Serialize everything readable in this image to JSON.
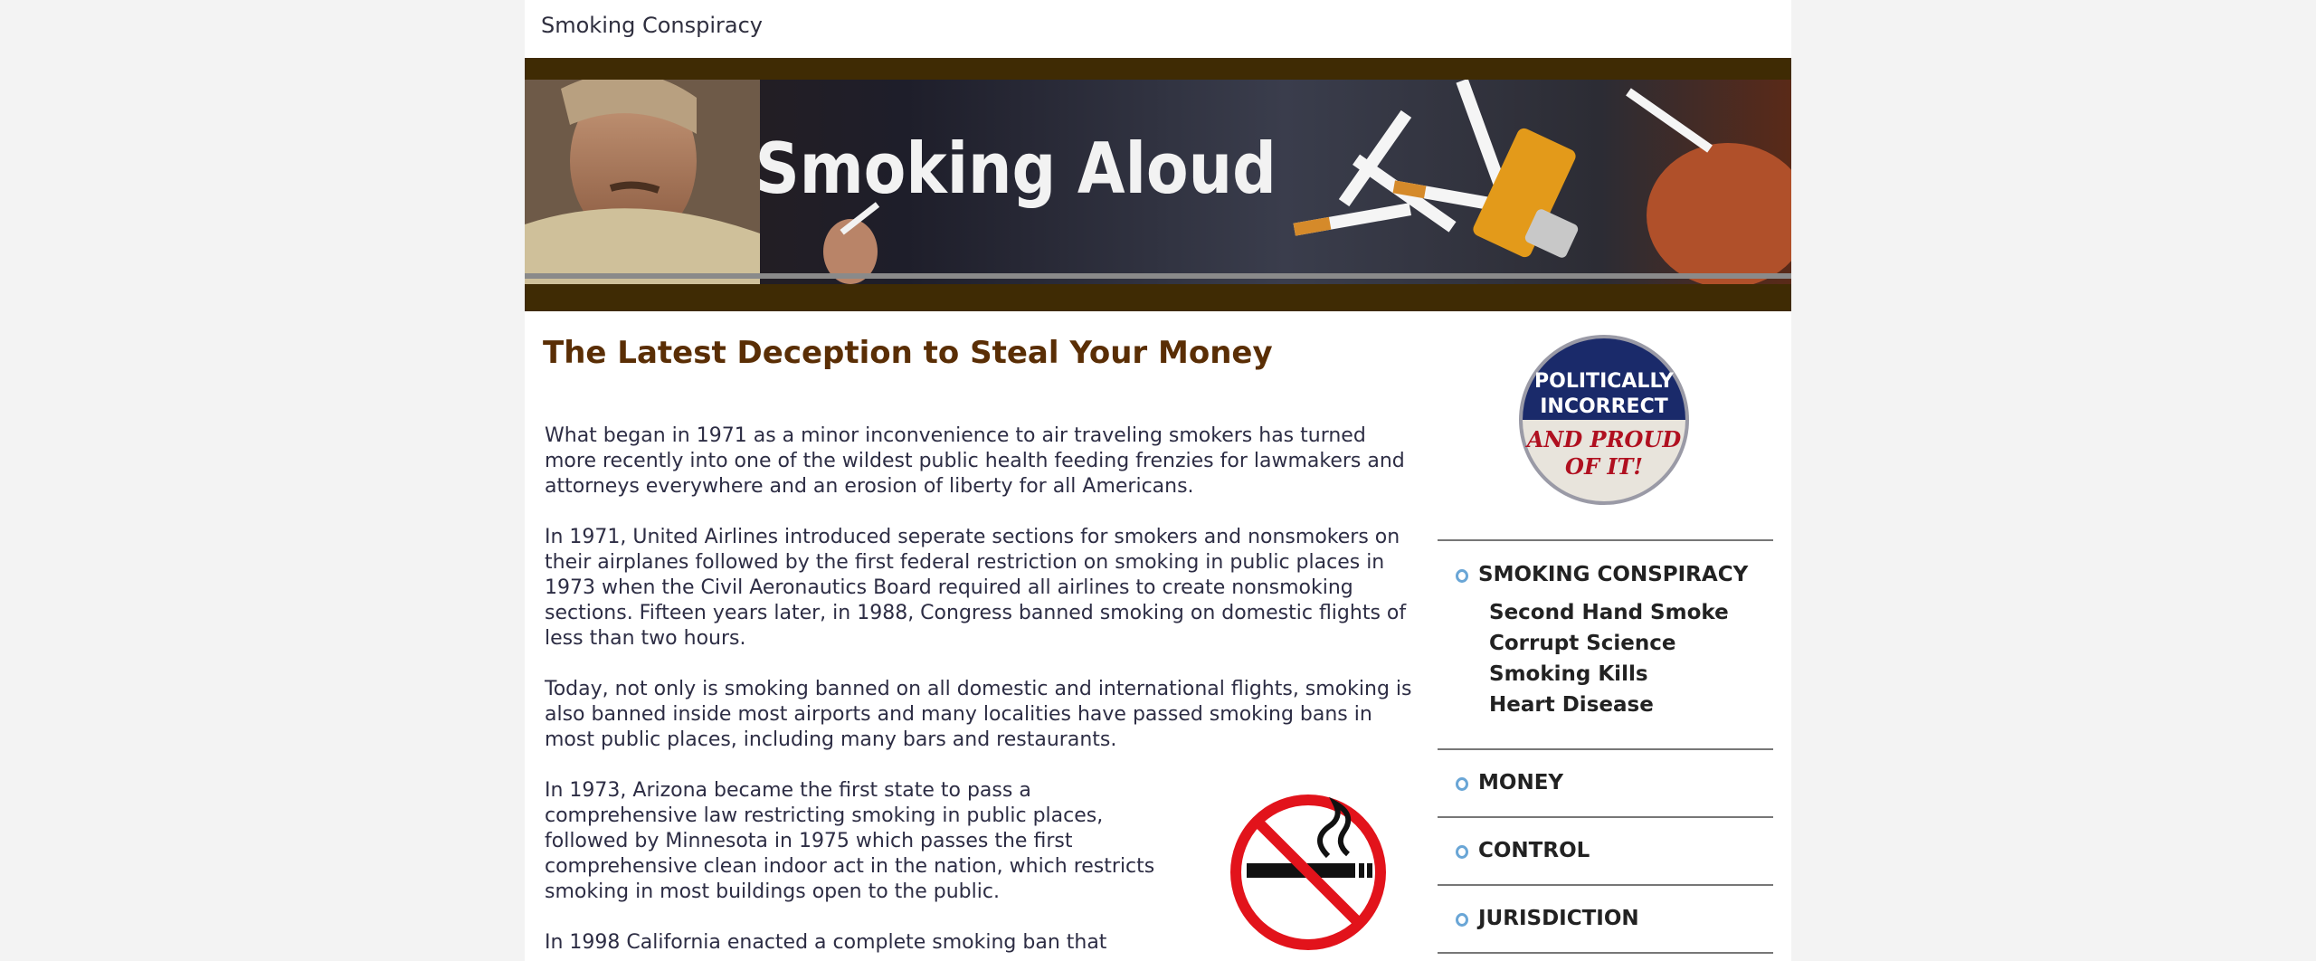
{
  "site": {
    "title": "Smoking Conspiracy"
  },
  "banner": {
    "title": "Smoking Aloud"
  },
  "article": {
    "headline": "The Latest Deception to Steal Your Money",
    "paragraphs": [
      "What began in 1971 as a minor inconvenience to air traveling smokers has turned more recently into one of the wildest public health feeding frenzies for lawmakers and attorneys everywhere and an erosion of liberty for all Americans.",
      "In 1971, United Airlines introduced seperate sections for smokers and nonsmokers on their airplanes followed by the first federal restriction on smoking in public places in 1973 when the Civil Aeronautics Board required all airlines to create nonsmoking sections. Fifteen years later, in 1988, Congress banned smoking on domestic flights of less than two hours.",
      "Today, not only is smoking banned on all domestic and international flights, smoking is also banned inside most airports and many localities have passed smoking bans in most public places, including many bars and restaurants.",
      "In 1973, Arizona became the first state to pass a comprehensive law restricting smoking in public places, followed by Minnesota in 1975 which passes the first comprehensive clean indoor act in the nation, which restricts smoking in most buildings open to the public.",
      "In 1998 California enacted a complete smoking ban that"
    ]
  },
  "sidebar": {
    "badge": {
      "line1": "POLITICALLY",
      "line2": "INCORRECT",
      "line3": "AND PROUD",
      "line4": "OF IT!"
    },
    "nav": [
      {
        "label": "SMOKING CONSPIRACY",
        "children": [
          "Second Hand Smoke",
          "Corrupt Science",
          "Smoking Kills",
          "Heart Disease"
        ]
      },
      {
        "label": "MONEY"
      },
      {
        "label": "CONTROL"
      },
      {
        "label": "JURISDICTION"
      }
    ]
  },
  "colors": {
    "headline": "#5a2e05",
    "banner_bar": "#3f2b04",
    "bullet": "#6aa6d6",
    "nosmoke_red": "#e2131b"
  },
  "icons": [
    "no-smoking-icon",
    "politically-incorrect-badge",
    "nav-bullet-icon"
  ]
}
